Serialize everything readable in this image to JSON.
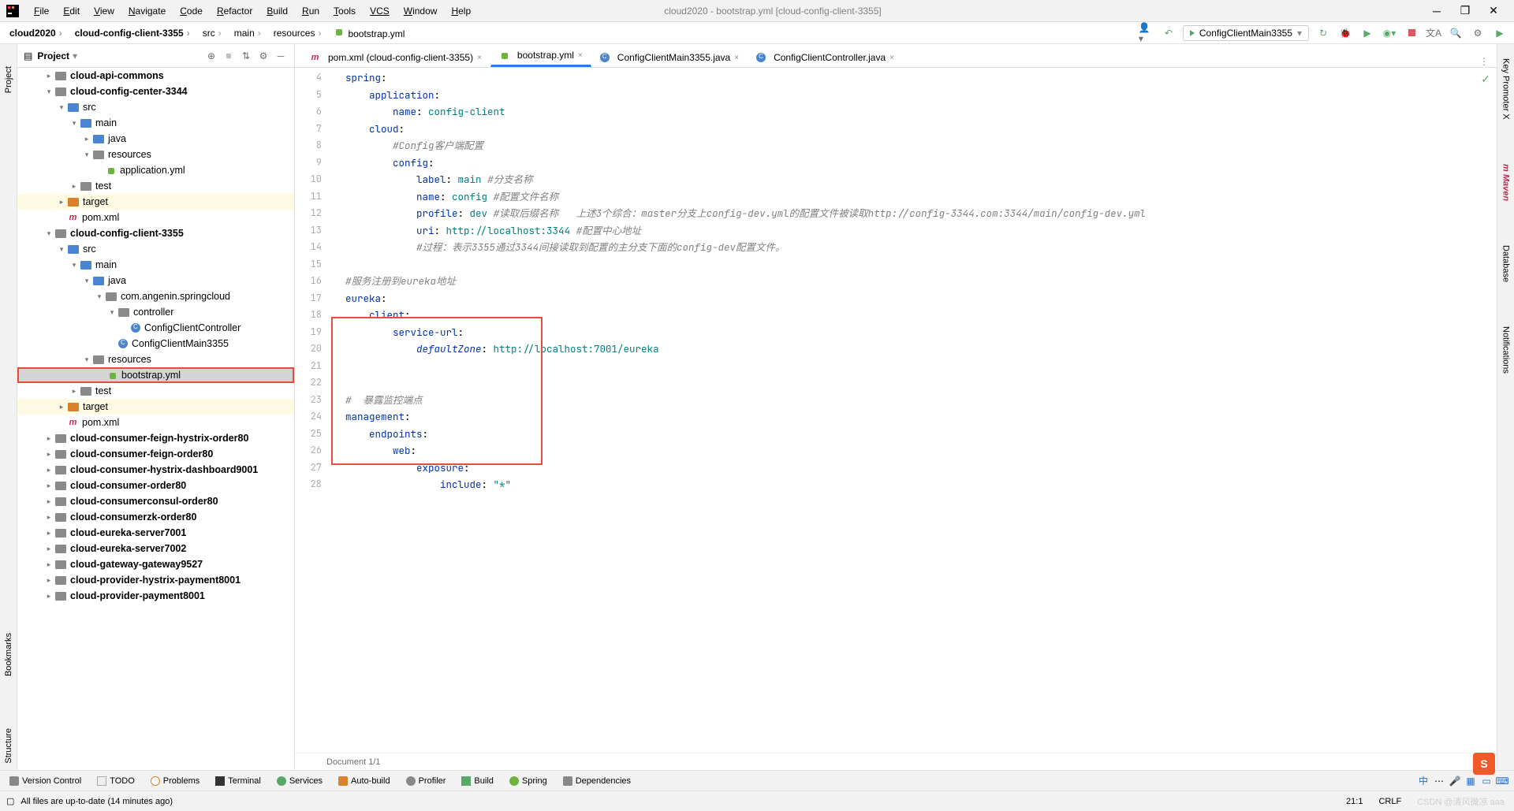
{
  "menu": {
    "items": [
      "File",
      "Edit",
      "View",
      "Navigate",
      "Code",
      "Refactor",
      "Build",
      "Run",
      "Tools",
      "VCS",
      "Window",
      "Help"
    ],
    "underlines": [
      "F",
      "E",
      "V",
      "N",
      "C",
      "R",
      "B",
      "R",
      "T",
      "VCS",
      "W",
      "H"
    ]
  },
  "window_title": "cloud2020 - bootstrap.yml [cloud-config-client-3355]",
  "breadcrumbs": [
    "cloud2020",
    "cloud-config-client-3355",
    "src",
    "main",
    "resources",
    "bootstrap.yml"
  ],
  "run_config": "ConfigClientMain3355",
  "project_panel": {
    "title": "Project",
    "tree": [
      {
        "label": "cloud-api-commons",
        "indent": 2,
        "arrow": "right",
        "icon": "folder",
        "bold": true
      },
      {
        "label": "cloud-config-center-3344",
        "indent": 2,
        "arrow": "down",
        "icon": "folder",
        "bold": true
      },
      {
        "label": "src",
        "indent": 3,
        "arrow": "down",
        "icon": "folder-blue"
      },
      {
        "label": "main",
        "indent": 4,
        "arrow": "down",
        "icon": "folder-blue"
      },
      {
        "label": "java",
        "indent": 5,
        "arrow": "right",
        "icon": "folder-blue"
      },
      {
        "label": "resources",
        "indent": 5,
        "arrow": "down",
        "icon": "folder"
      },
      {
        "label": "application.yml",
        "indent": 6,
        "arrow": "none",
        "icon": "yml"
      },
      {
        "label": "test",
        "indent": 4,
        "arrow": "right",
        "icon": "folder"
      },
      {
        "label": "target",
        "indent": 3,
        "arrow": "right",
        "icon": "folder-orange",
        "hl": true
      },
      {
        "label": "pom.xml",
        "indent": 3,
        "arrow": "none",
        "icon": "m"
      },
      {
        "label": "cloud-config-client-3355",
        "indent": 2,
        "arrow": "down",
        "icon": "folder",
        "bold": true
      },
      {
        "label": "src",
        "indent": 3,
        "arrow": "down",
        "icon": "folder-blue"
      },
      {
        "label": "main",
        "indent": 4,
        "arrow": "down",
        "icon": "folder-blue"
      },
      {
        "label": "java",
        "indent": 5,
        "arrow": "down",
        "icon": "folder-blue"
      },
      {
        "label": "com.angenin.springcloud",
        "indent": 6,
        "arrow": "down",
        "icon": "folder"
      },
      {
        "label": "controller",
        "indent": 7,
        "arrow": "down",
        "icon": "folder"
      },
      {
        "label": "ConfigClientController",
        "indent": 8,
        "arrow": "none",
        "icon": "class"
      },
      {
        "label": "ConfigClientMain3355",
        "indent": 7,
        "arrow": "none",
        "icon": "class-run"
      },
      {
        "label": "resources",
        "indent": 5,
        "arrow": "down",
        "icon": "folder"
      },
      {
        "label": "bootstrap.yml",
        "indent": 6,
        "arrow": "none",
        "icon": "yml",
        "selected": true,
        "redbox": true
      },
      {
        "label": "test",
        "indent": 4,
        "arrow": "right",
        "icon": "folder"
      },
      {
        "label": "target",
        "indent": 3,
        "arrow": "right",
        "icon": "folder-orange",
        "hl": true
      },
      {
        "label": "pom.xml",
        "indent": 3,
        "arrow": "none",
        "icon": "m"
      },
      {
        "label": "cloud-consumer-feign-hystrix-order80",
        "indent": 2,
        "arrow": "right",
        "icon": "folder",
        "bold": true
      },
      {
        "label": "cloud-consumer-feign-order80",
        "indent": 2,
        "arrow": "right",
        "icon": "folder",
        "bold": true
      },
      {
        "label": "cloud-consumer-hystrix-dashboard9001",
        "indent": 2,
        "arrow": "right",
        "icon": "folder",
        "bold": true
      },
      {
        "label": "cloud-consumer-order80",
        "indent": 2,
        "arrow": "right",
        "icon": "folder",
        "bold": true
      },
      {
        "label": "cloud-consumerconsul-order80",
        "indent": 2,
        "arrow": "right",
        "icon": "folder",
        "bold": true
      },
      {
        "label": "cloud-consumerzk-order80",
        "indent": 2,
        "arrow": "right",
        "icon": "folder",
        "bold": true
      },
      {
        "label": "cloud-eureka-server7001",
        "indent": 2,
        "arrow": "right",
        "icon": "folder",
        "bold": true
      },
      {
        "label": "cloud-eureka-server7002",
        "indent": 2,
        "arrow": "right",
        "icon": "folder",
        "bold": true
      },
      {
        "label": "cloud-gateway-gateway9527",
        "indent": 2,
        "arrow": "right",
        "icon": "folder",
        "bold": true
      },
      {
        "label": "cloud-provider-hystrix-payment8001",
        "indent": 2,
        "arrow": "right",
        "icon": "folder",
        "bold": true
      },
      {
        "label": "cloud-provider-payment8001",
        "indent": 2,
        "arrow": "right",
        "icon": "folder",
        "bold": true
      }
    ]
  },
  "tabs": [
    {
      "label": "pom.xml (cloud-config-client-3355)",
      "icon": "m",
      "active": false
    },
    {
      "label": "bootstrap.yml",
      "icon": "yml",
      "active": true
    },
    {
      "label": "ConfigClientMain3355.java",
      "icon": "class",
      "active": false
    },
    {
      "label": "ConfigClientController.java",
      "icon": "class",
      "active": false
    }
  ],
  "gutter_start": 4,
  "gutter_end": 28,
  "code_lines": [
    {
      "t": [
        {
          "k": "spring"
        },
        {
          "p": ":"
        }
      ]
    },
    {
      "t": [
        {
          "sp": 2
        },
        {
          "k": "application"
        },
        {
          "p": ":"
        }
      ]
    },
    {
      "t": [
        {
          "sp": 4
        },
        {
          "k": "name"
        },
        {
          "p": ": "
        },
        {
          "v": "config-client"
        }
      ]
    },
    {
      "t": [
        {
          "sp": 2
        },
        {
          "k": "cloud"
        },
        {
          "p": ":"
        }
      ]
    },
    {
      "t": [
        {
          "sp": 4
        },
        {
          "c": "#Config客户端配置"
        }
      ]
    },
    {
      "t": [
        {
          "sp": 4
        },
        {
          "k": "config"
        },
        {
          "p": ":"
        }
      ]
    },
    {
      "t": [
        {
          "sp": 6
        },
        {
          "k": "label"
        },
        {
          "p": ": "
        },
        {
          "v": "main"
        },
        {
          "p": " "
        },
        {
          "c": "#分支名称"
        }
      ]
    },
    {
      "t": [
        {
          "sp": 6
        },
        {
          "k": "name"
        },
        {
          "p": ": "
        },
        {
          "v": "config"
        },
        {
          "p": " "
        },
        {
          "c": "#配置文件名称"
        }
      ]
    },
    {
      "t": [
        {
          "sp": 6
        },
        {
          "k": "profile"
        },
        {
          "p": ": "
        },
        {
          "v": "dev"
        },
        {
          "p": " "
        },
        {
          "c": "#读取后缀名称   上述3个综合：master分支上config-dev.yml的配置文件被读取http://config-3344.com:3344/main/config-dev.yml"
        }
      ]
    },
    {
      "t": [
        {
          "sp": 6
        },
        {
          "k": "uri"
        },
        {
          "p": ": "
        },
        {
          "v": "http://localhost:3344"
        },
        {
          "p": " "
        },
        {
          "c": "#配置中心地址"
        }
      ]
    },
    {
      "t": [
        {
          "sp": 6
        },
        {
          "c": "#过程：表示3355通过3344间接读取到配置的主分支下面的config-dev配置文件。"
        }
      ]
    },
    {
      "t": []
    },
    {
      "t": [
        {
          "c": "#服务注册到eureka地址"
        }
      ]
    },
    {
      "t": [
        {
          "k": "eureka"
        },
        {
          "p": ":"
        }
      ]
    },
    {
      "t": [
        {
          "sp": 2
        },
        {
          "k": "client"
        },
        {
          "p": ":"
        }
      ]
    },
    {
      "t": [
        {
          "sp": 4
        },
        {
          "k": "service-url"
        },
        {
          "p": ":"
        }
      ]
    },
    {
      "t": [
        {
          "sp": 6
        },
        {
          "ki": "defaultZone"
        },
        {
          "p": ": "
        },
        {
          "v": "http://localhost:7001/eureka"
        }
      ]
    },
    {
      "t": [],
      "caret": true
    },
    {
      "t": []
    },
    {
      "t": [
        {
          "c": "#  暴露监控端点"
        }
      ]
    },
    {
      "t": [
        {
          "k": "management"
        },
        {
          "p": ":"
        }
      ]
    },
    {
      "t": [
        {
          "sp": 2
        },
        {
          "k": "endpoints"
        },
        {
          "p": ":"
        }
      ]
    },
    {
      "t": [
        {
          "sp": 4
        },
        {
          "k": "web"
        },
        {
          "p": ":"
        }
      ]
    },
    {
      "t": [
        {
          "sp": 6
        },
        {
          "k": "exposure"
        },
        {
          "p": ":"
        }
      ]
    },
    {
      "t": [
        {
          "sp": 8
        },
        {
          "k": "include"
        },
        {
          "p": ": "
        },
        {
          "s": "\"*\""
        }
      ]
    }
  ],
  "editor_footer": "Document 1/1",
  "bottom_tools": [
    "Version Control",
    "TODO",
    "Problems",
    "Terminal",
    "Services",
    "Auto-build",
    "Profiler",
    "Build",
    "Spring",
    "Dependencies"
  ],
  "status_message": "All files are up-to-date (14 minutes ago)",
  "status_right": {
    "pos": "21:1",
    "sep": "CRLF",
    "watermark": "CSDN @清风微凉 aaa"
  },
  "left_strip": [
    "Project",
    "Bookmarks",
    "Structure"
  ],
  "right_strip": [
    "Key Promoter X",
    "Maven",
    "Database",
    "Notifications"
  ]
}
